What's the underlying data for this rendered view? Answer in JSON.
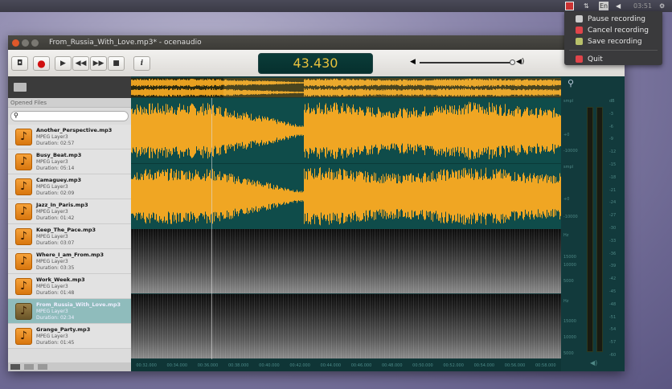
{
  "panel": {
    "lang": "En",
    "clock": "03:51"
  },
  "tray_menu": {
    "items": [
      {
        "label": "Pause recording",
        "icon": "pause-icon",
        "color": "#cccccc"
      },
      {
        "label": "Cancel recording",
        "icon": "cancel-icon",
        "color": "#e0444a"
      },
      {
        "label": "Save recording",
        "icon": "save-icon",
        "color": "#b8c06a"
      },
      {
        "label": "Quit",
        "icon": "quit-icon",
        "color": "#e0444a"
      }
    ]
  },
  "window": {
    "title": "From_Russia_With_Love.mp3* - ocenaudio"
  },
  "toolbar": {
    "time": "43.430",
    "accent": "#e9c23d"
  },
  "sidebar": {
    "header": "Opened Files",
    "search_placeholder": "",
    "files": [
      {
        "name": "Another_Perspective.mp3",
        "codec": "MPEG Layer3",
        "duration": "Duration: 02:57"
      },
      {
        "name": "Busy_Beat.mp3",
        "codec": "MPEG Layer3",
        "duration": "Duration: 05:14"
      },
      {
        "name": "Camaguey.mp3",
        "codec": "MPEG Layer3",
        "duration": "Duration: 02:09"
      },
      {
        "name": "Jazz_In_Paris.mp3",
        "codec": "MPEG Layer3",
        "duration": "Duration: 01:42"
      },
      {
        "name": "Keep_The_Pace.mp3",
        "codec": "MPEG Layer3",
        "duration": "Duration: 03:07"
      },
      {
        "name": "Where_I_am_From.mp3",
        "codec": "MPEG Layer3",
        "duration": "Duration: 03:35"
      },
      {
        "name": "Work_Week.mp3",
        "codec": "MPEG Layer3",
        "duration": "Duration: 01:48"
      },
      {
        "name": "From_Russia_With_Love.mp3",
        "codec": "MPEG Layer3",
        "duration": "Duration: 02:34",
        "selected": true
      },
      {
        "name": "Grange_Party.mp3",
        "codec": "MPEG Layer3",
        "duration": "Duration: 01:45"
      }
    ]
  },
  "scales": {
    "wave": [
      "smpl",
      "+0",
      "-10000",
      "smpl",
      "+0",
      "-10000"
    ],
    "spec": [
      "Hz",
      "15000",
      "10000",
      "5000",
      "Hz",
      "15000",
      "10000",
      "5000"
    ],
    "db": [
      "dB",
      "-3",
      "-6",
      "-9",
      "-12",
      "-15",
      "-18",
      "-21",
      "-24",
      "-27",
      "-30",
      "-33",
      "-36",
      "-39",
      "-42",
      "-45",
      "-48",
      "-51",
      "-54",
      "-57",
      "-60"
    ]
  },
  "timeline": [
    "00:32.000",
    "00:34.000",
    "00:36.000",
    "00:38.000",
    "00:40.000",
    "00:42.000",
    "00:44.000",
    "00:46.000",
    "00:48.000",
    "00:50.000",
    "00:52.000",
    "00:54.000",
    "00:56.000",
    "00:58.000"
  ]
}
